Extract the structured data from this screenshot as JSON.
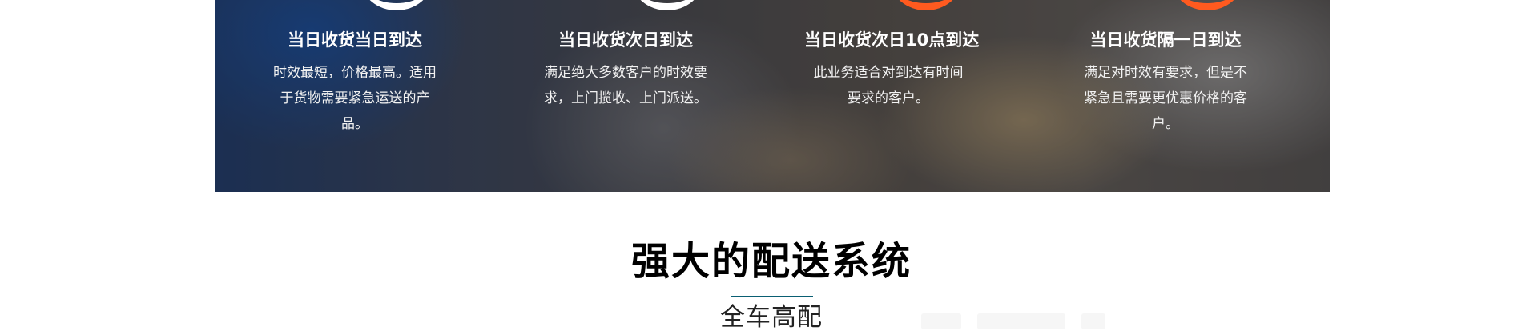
{
  "services": [
    {
      "title": "当日收货当日到达",
      "description": "时效最短，价格最高。适用于货物需要紧急运送的产品。"
    },
    {
      "title": "当日收货次日到达",
      "description": "满足绝大多数客户的时效要求，上门揽收、上门派送。"
    },
    {
      "title": "当日收货次日10点到达",
      "description": "此业务适合对到达有时间要求的客户。"
    },
    {
      "title": "当日收货隔一日到达",
      "description": "满足对时效有要求，但是不紧急且需要更优惠价格的客户。"
    }
  ],
  "section": {
    "title": "强大的配送系统",
    "active_tab": "全车高配"
  },
  "colors": {
    "ring_white": "#ffffff",
    "ring_orange": "#ff5a1f",
    "tab_indicator": "#0a5f73"
  }
}
